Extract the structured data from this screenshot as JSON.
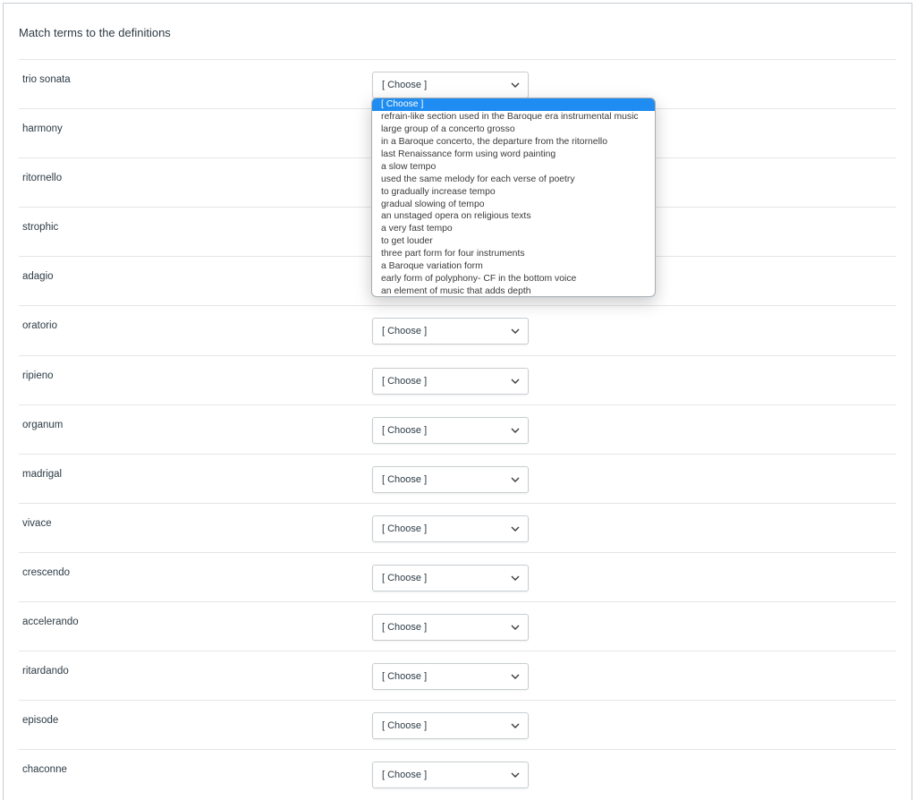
{
  "question": {
    "text": "Match terms to the definitions"
  },
  "select_placeholder": "[ Choose ]",
  "rows": [
    {
      "term": "trio sonata",
      "selected": "[ Choose ]"
    },
    {
      "term": "harmony",
      "selected": "[ Choose ]"
    },
    {
      "term": "ritornello",
      "selected": "[ Choose ]"
    },
    {
      "term": "strophic",
      "selected": "[ Choose ]"
    },
    {
      "term": "adagio",
      "selected": "[ Choose ]"
    },
    {
      "term": "oratorio",
      "selected": "[ Choose ]"
    },
    {
      "term": "ripieno",
      "selected": "[ Choose ]"
    },
    {
      "term": "organum",
      "selected": "[ Choose ]"
    },
    {
      "term": "madrigal",
      "selected": "[ Choose ]"
    },
    {
      "term": "vivace",
      "selected": "[ Choose ]"
    },
    {
      "term": "crescendo",
      "selected": "[ Choose ]"
    },
    {
      "term": "accelerando",
      "selected": "[ Choose ]"
    },
    {
      "term": "ritardando",
      "selected": "[ Choose ]"
    },
    {
      "term": "episode",
      "selected": "[ Choose ]"
    },
    {
      "term": "chaconne",
      "selected": "[ Choose ]"
    }
  ],
  "open_dropdown": {
    "row_index": 0,
    "highlighted_index": 0,
    "options": [
      "[ Choose ]",
      "refrain-like section used in the Baroque era instrumental music",
      "large group of a concerto grosso",
      "in a Baroque concerto, the departure from the ritornello",
      "last Renaissance form using word painting",
      "a slow tempo",
      "used the same melody for each verse of poetry",
      "to gradually increase tempo",
      "gradual slowing of tempo",
      "an unstaged opera on religious texts",
      "a very fast tempo",
      "to get louder",
      "three part form for four instruments",
      "a Baroque variation form",
      "early form of polyphony- CF in the bottom voice",
      "an element of music that adds depth"
    ]
  },
  "colors": {
    "highlight": "#1e8cf0",
    "text": "#2d3b45",
    "border": "#c7cdd1"
  },
  "icons": {
    "select_arrow": "chevron-down-icon"
  }
}
